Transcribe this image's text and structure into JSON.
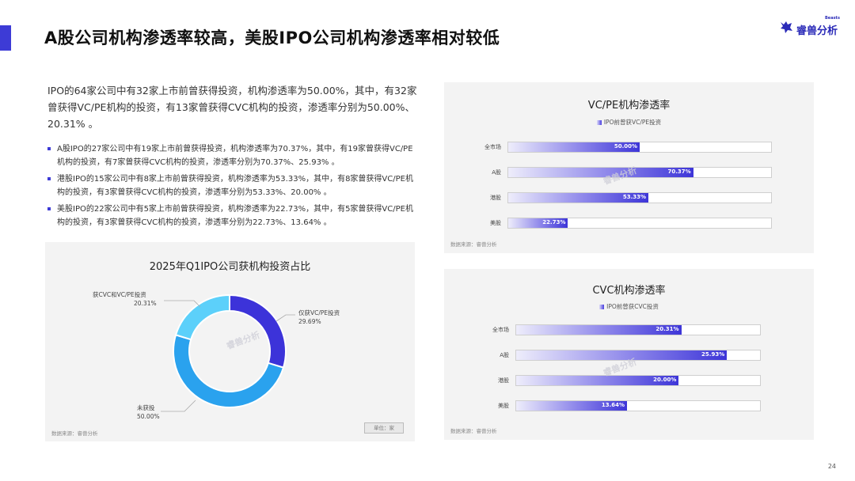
{
  "header": {
    "title": "A股公司机构渗透率较高，美股IPO公司机构渗透率相对较低",
    "logo_text": "睿兽分析",
    "logo_sup": "Beasts"
  },
  "intro": "IPO的64家公司中有32家上市前曾获得投资，机构渗透率为50.00%，其中，有32家曾获得VC/PE机构的投资，有13家曾获得CVC机构的投资，渗透率分别为50.00%、20.31% 。",
  "bullets": [
    "A股IPO的27家公司中有19家上市前曾获得投资，机构渗透率为70.37%，其中，有19家曾获得VC/PE机构的投资，有7家曾获得CVC机构的投资，渗透率分别为70.37%、25.93% 。",
    "港股IPO的15家公司中有8家上市前曾获得投资，机构渗透率为53.33%，其中，有8家曾获得VC/PE机构的投资，有3家曾获得CVC机构的投资，渗透率分别为53.33%、20.00% 。",
    "美股IPO的22家公司中有5家上市前曾获得投资，机构渗透率为22.73%，其中，有5家曾获得VC/PE机构的投资，有3家曾获得CVC机构的投资，渗透率分别为22.73%、13.64% 。"
  ],
  "pie": {
    "source": "数据来源：睿兽分析",
    "unit_button": "单位：家",
    "watermark": "睿兽分析",
    "labels": {
      "cvc_name": "获CVC和VC/PE投资",
      "cvc_value": "20.31%",
      "vcpe_name": "仅获VC/PE投资",
      "vcpe_value": "29.69%",
      "none_name": "未获投",
      "none_value": "50.00%"
    }
  },
  "vc_panel": {
    "source": "数据来源：睿兽分析",
    "watermark": "睿兽分析"
  },
  "cvc_panel": {
    "source": "数据来源：睿兽分析",
    "watermark": "睿兽分析"
  },
  "page_number": "24",
  "colors": {
    "accent": "#3d3bd6",
    "pie_vcpe": "#3c33d9",
    "pie_none": "#2aa2ee",
    "pie_cvc": "#5cd0fa"
  },
  "chart_data": [
    {
      "type": "pie",
      "title": "2025年Q1IPO公司获机构投资占比",
      "categories": [
        "仅获VC/PE投资",
        "未获投",
        "获CVC和VC/PE投资"
      ],
      "values": [
        29.69,
        50.0,
        20.31
      ],
      "unit": "%"
    },
    {
      "type": "bar",
      "title": "VC/PE机构渗透率",
      "categories": [
        "全市场",
        "A股",
        "港股",
        "美股"
      ],
      "series": [
        {
          "name": "IPO前曾获VC/PE投资",
          "values": [
            50.0,
            70.37,
            53.33,
            22.73
          ]
        }
      ],
      "labels": [
        "50.00%",
        "70.37%",
        "53.33%",
        "22.73%"
      ],
      "xlim": [
        0,
        100
      ]
    },
    {
      "type": "bar",
      "title": "CVC机构渗透率",
      "categories": [
        "全市场",
        "A股",
        "港股",
        "美股"
      ],
      "series": [
        {
          "name": "IPO前曾获CVC投资",
          "values": [
            20.31,
            25.93,
            20.0,
            13.64
          ]
        }
      ],
      "labels": [
        "20.31%",
        "25.93%",
        "20.00%",
        "13.64%"
      ],
      "xlim": [
        0,
        30
      ]
    }
  ]
}
